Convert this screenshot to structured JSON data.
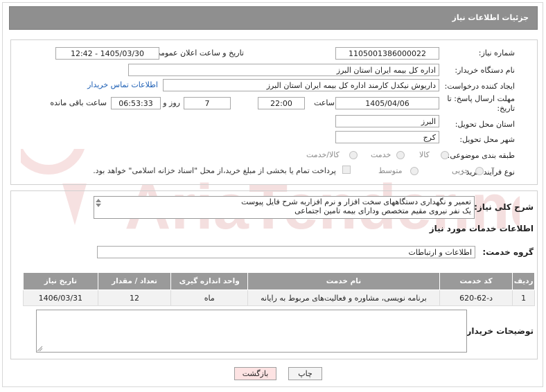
{
  "header": {
    "title": "جزئیات اطلاعات نیاز"
  },
  "form": {
    "need_number": {
      "label": "شماره نیاز:",
      "value": "1105001386000022"
    },
    "announce_datetime": {
      "label": "تاریخ و ساعت اعلان عمومی:",
      "value": "1405/03/30 - 12:42"
    },
    "buyer_org": {
      "label": "نام دستگاه خریدار:",
      "value": "اداره کل بیمه ایران استان البرز"
    },
    "creator": {
      "label": "ایجاد کننده درخواست:",
      "value": "داریوش  نیکدل کارمند  اداره کل بیمه ایران استان البرز",
      "contact_link": "اطلاعات تماس خریدار"
    },
    "deadline": {
      "label_line1": "مهلت ارسال پاسخ: تا",
      "label_line2": "تاریخ:",
      "date": "1405/04/06",
      "time_label": "ساعت",
      "time": "22:00",
      "days": "7",
      "days_label": "روز و",
      "remaining": "06:53:33",
      "remaining_label": "ساعت باقی مانده"
    },
    "province": {
      "label": "استان محل تحویل:",
      "value": "البرز"
    },
    "city": {
      "label": "شهر محل تحویل:",
      "value": "کرج"
    },
    "category": {
      "label": "طبقه بندی موضوعی:",
      "options": [
        "کالا",
        "خدمت",
        "کالا/خدمت"
      ]
    },
    "purchase_type": {
      "label": "نوع فرآیند خرید :",
      "options": [
        "جزیی",
        "متوسط"
      ],
      "note": "پرداخت تمام یا بخشی از مبلغ خرید،از محل \"اسناد خزانه اسلامی\" خواهد بود."
    }
  },
  "description": {
    "label": "شرح کلی نیاز:",
    "line1": "تعمیر و نگهداری دستگاههای سخت افزار و نرم افزاربه شرح فایل پیوست",
    "line2": "یک نفر نیروی مقیم متخصص ودارای بیمه تامین اجتماعی"
  },
  "services": {
    "section_title": "اطلاعات خدمات مورد نیاز",
    "group_label": "گروه خدمت:",
    "group_value": "اطلاعات و ارتباطات",
    "columns": [
      "ردیف",
      "کد خدمت",
      "نام خدمت",
      "واحد اندازه گیری",
      "تعداد / مقدار",
      "تاریخ نیاز"
    ],
    "rows": [
      {
        "index": "1",
        "code": "د-62-620",
        "name": "برنامه نویسی، مشاوره و فعالیت‌های مربوط به رایانه",
        "unit": "ماه",
        "qty": "12",
        "date": "1406/03/31"
      }
    ]
  },
  "buyer_notes": {
    "label": "توضیحات خریدار:",
    "value": ""
  },
  "buttons": {
    "print": "چاپ",
    "back": "بازگشت"
  },
  "watermark": {
    "text": "AriaTender.net"
  },
  "colors": {
    "header": "#8f8f8f",
    "link": "#1d5fb5",
    "back_button": "#fde3e3",
    "watermark": "#f2d8d8"
  }
}
